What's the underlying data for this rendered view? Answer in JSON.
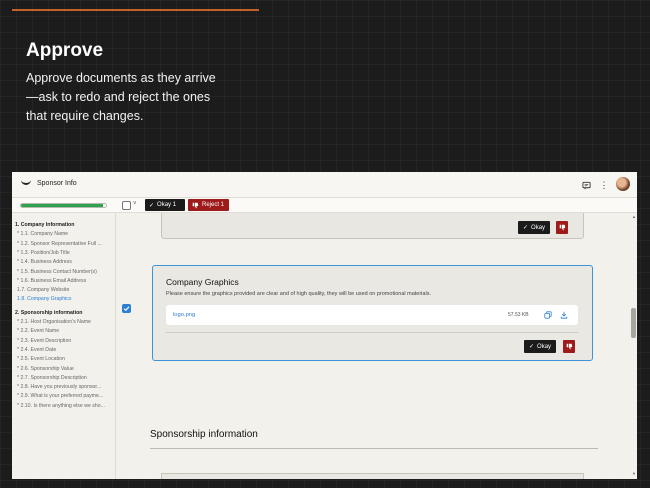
{
  "hero": {
    "title": "Approve",
    "description": "Approve documents as they arrive—ask to redo and reject the ones that require changes."
  },
  "app": {
    "title": "Sponsor Info",
    "icons": [
      "logo-icon",
      "chat-icon",
      "more-vertical-icon",
      "avatar"
    ]
  },
  "toolbar": {
    "progress": 0.97,
    "okay_label": "Okay 1",
    "reject_label": "Reject 1"
  },
  "sidebar": {
    "items": [
      {
        "label": "1. Company Information",
        "kind": "section"
      },
      {
        "label": "* 1.1. Company Name",
        "kind": "item"
      },
      {
        "label": "* 1.2. Sponsor Representative Full ...",
        "kind": "item"
      },
      {
        "label": "* 1.3. Position/Job Title",
        "kind": "item"
      },
      {
        "label": "* 1.4. Business Address",
        "kind": "item"
      },
      {
        "label": "* 1.5. Business Contact Number(s)",
        "kind": "item"
      },
      {
        "label": "* 1.6. Business Email Address",
        "kind": "item"
      },
      {
        "label": "1.7. Company Website",
        "kind": "item"
      },
      {
        "label": "1.8. Company Graphics",
        "kind": "active"
      },
      {
        "label": "2. Sponsorship information",
        "kind": "section"
      },
      {
        "label": "* 2.1. Host Organisation's Name",
        "kind": "item"
      },
      {
        "label": "* 2.2. Event Name",
        "kind": "item"
      },
      {
        "label": "* 2.3. Event Description",
        "kind": "item"
      },
      {
        "label": "* 2.4. Event Date",
        "kind": "item"
      },
      {
        "label": "* 2.5. Event Location",
        "kind": "item"
      },
      {
        "label": "* 2.6. Sponsorship Value",
        "kind": "item"
      },
      {
        "label": "* 2.7. Sponsorship Description",
        "kind": "item"
      },
      {
        "label": "* 2.8. Have you previously sponsor...",
        "kind": "item"
      },
      {
        "label": "* 2.9. What is your preferred payme...",
        "kind": "item"
      },
      {
        "label": "* 2.10. Is there anything else we sho...",
        "kind": "item"
      }
    ]
  },
  "main": {
    "prev_okay_label": "Okay",
    "card": {
      "title": "Company Graphics",
      "description": "Please ensure the graphics provided are clear and of high quality, they will be used on promotional materials.",
      "file_name": "logo.png",
      "file_size": "57.53 KB",
      "okay_label": "Okay"
    },
    "section_heading": "Sponsorship information"
  },
  "colors": {
    "accent": "#c0622a",
    "okay": "#1b1b1b",
    "reject": "#9e1b1b",
    "link": "#2d7fd3",
    "progress": "#2fa24f"
  }
}
